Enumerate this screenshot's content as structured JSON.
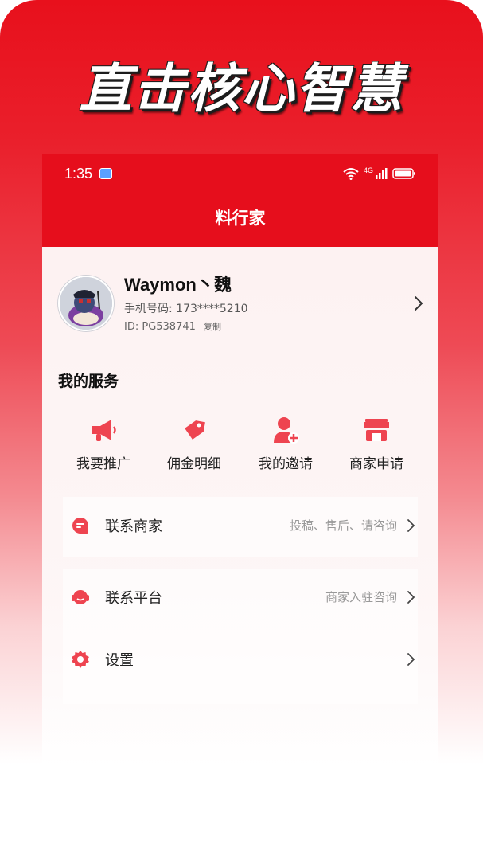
{
  "promo": {
    "headline": "直击核心智慧"
  },
  "status_bar": {
    "time": "1:35",
    "network": "4G"
  },
  "app": {
    "title": "料行家"
  },
  "profile": {
    "name": "Waymon丶魏",
    "phone_label": "手机号码: 173****5210",
    "id_label": "ID: PG538741",
    "copy_label": "复制"
  },
  "services": {
    "title": "我的服务",
    "items": [
      {
        "label": "我要推广",
        "icon": "megaphone-icon"
      },
      {
        "label": "佣金明细",
        "icon": "tag-icon"
      },
      {
        "label": "我的邀请",
        "icon": "add-user-icon"
      },
      {
        "label": "商家申请",
        "icon": "shop-icon"
      }
    ]
  },
  "menu": [
    {
      "label": "联系商家",
      "hint": "投稿、售后、请咨询",
      "icon": "chat-icon"
    },
    {
      "label": "联系平台",
      "hint": "商家入驻咨询",
      "icon": "headset-icon"
    },
    {
      "label": "设置",
      "hint": "",
      "icon": "gear-icon"
    }
  ],
  "colors": {
    "brand_red": "#e60e1c",
    "icon_red": "#ee4450"
  }
}
